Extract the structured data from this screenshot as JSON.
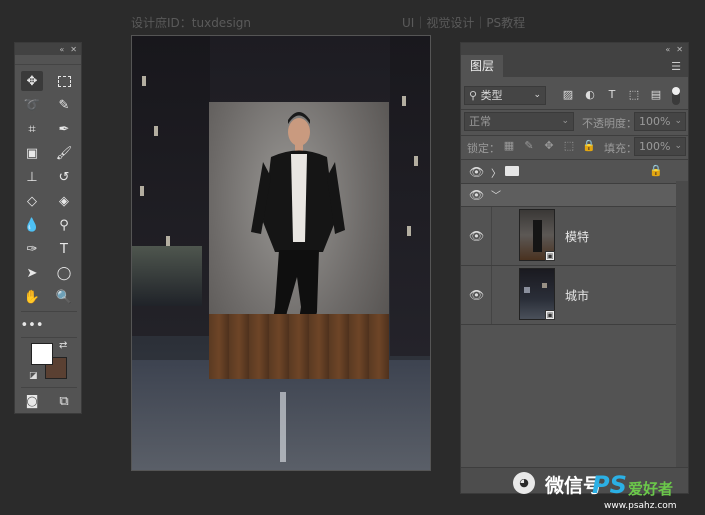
{
  "header": {
    "designer_id": "设计庶ID：tuxdesign",
    "site_breadcrumb": "UI｜视觉设计｜PS教程"
  },
  "toolbar": {
    "collapse_icon": "double-chevron",
    "close_icon": "x",
    "colors": {
      "foreground": "#ffffff",
      "background": "#5a4032"
    }
  },
  "layers_panel": {
    "tab_label": "图层",
    "filter_kind": "类型",
    "blend_mode": "正常",
    "opacity_label": "不透明度：",
    "opacity_value": "100%",
    "lock_label": "锁定：",
    "fill_label": "填充：",
    "fill_value": "100%",
    "group_expand_glyph": "〉",
    "subgroup_collapse_glyph": "﹀",
    "layers": [
      {
        "name": "模特"
      },
      {
        "name": "城市"
      }
    ]
  },
  "watermark": {
    "wechat_label": "微信号",
    "site_logo": "PS",
    "site_logo_cn": "爱好者",
    "site_url": "www.psahz.com"
  }
}
